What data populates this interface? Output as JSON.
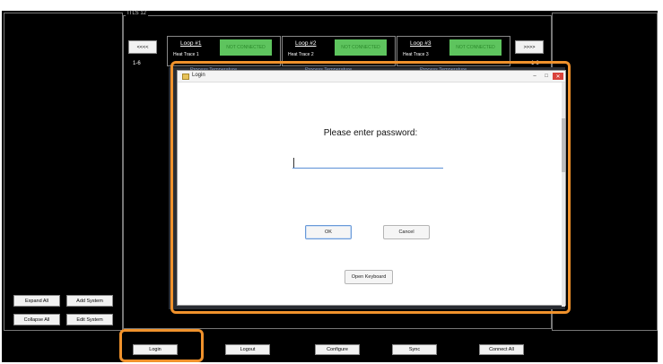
{
  "group_title": "ITLS 12",
  "left_panel": {
    "expand_all": "Expand All",
    "add_system": "Add System",
    "collapse_all": "Collapse All",
    "edit_system": "Edit System"
  },
  "nav": {
    "prev_label": "<<<<",
    "next_label": ">>>>",
    "range_left": "1-6",
    "range_right": "1-6"
  },
  "loops": [
    {
      "title": "Loop #1",
      "subtitle": "Heat Trace 1",
      "status": "NOT CONNECTED"
    },
    {
      "title": "Loop #2",
      "subtitle": "Heat Trace 2",
      "status": "NOT CONNECTED"
    },
    {
      "title": "Loop #3",
      "subtitle": "Heat Trace 3",
      "status": "NOT CONNECTED"
    }
  ],
  "background_labels": {
    "temp_1": "Process Temperature",
    "temp_2": "Process Temperature",
    "temp_3": "Process Temperature"
  },
  "dialog": {
    "title": "Login",
    "prompt": "Please enter password:",
    "password_value": "",
    "ok_label": "OK",
    "cancel_label": "Cancel",
    "keyboard_label": "Open Keyboard"
  },
  "toolbar": {
    "login": "Login",
    "logout": "Logout",
    "configure": "Configure",
    "sync": "Sync",
    "connect_all": "Connect All"
  },
  "colors": {
    "highlight": "#f0922c",
    "status_green": "#5ec45e",
    "background": "#000000"
  }
}
